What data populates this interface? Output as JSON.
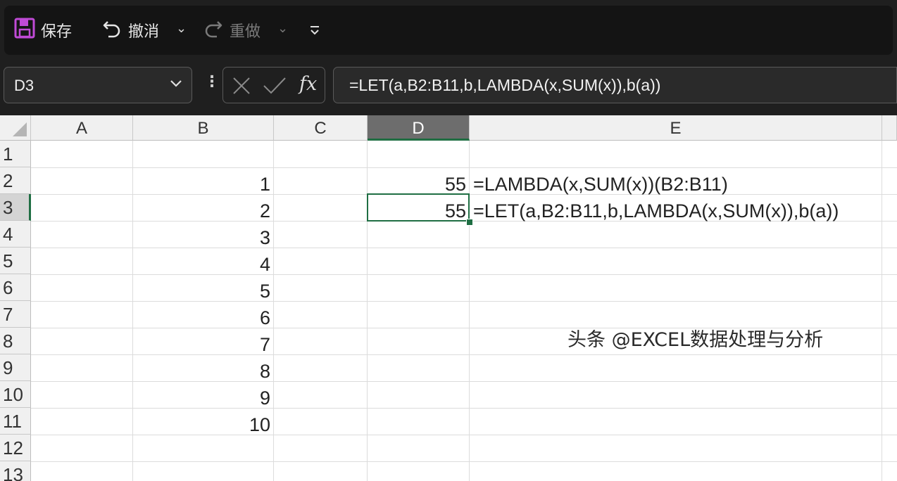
{
  "toolbar": {
    "save_label": "保存",
    "undo_label": "撤消",
    "redo_label": "重做"
  },
  "formula_bar": {
    "name_box": "D3",
    "fx_label": "fx",
    "formula": "=LET(a,B2:B11,b,LAMBDA(x,SUM(x)),b(a))"
  },
  "grid": {
    "columns": [
      "A",
      "B",
      "C",
      "D",
      "E"
    ],
    "selected_column": "D",
    "rows": [
      "1",
      "2",
      "3",
      "4",
      "5",
      "6",
      "7",
      "8",
      "9",
      "10",
      "11",
      "12",
      "13"
    ],
    "selected_row": "3",
    "column_b_values": [
      "1",
      "2",
      "3",
      "4",
      "5",
      "6",
      "7",
      "8",
      "9",
      "10"
    ],
    "d2_value": "55",
    "d3_value": "55",
    "e2_text": "=LAMBDA(x,SUM(x))(B2:B11)",
    "e3_text": "=LET(a,B2:B11,b,LAMBDA(x,SUM(x)),b(a))"
  },
  "watermark": "头条 @EXCEL数据处理与分析",
  "colors": {
    "selection": "#1f6e43",
    "save_icon": "#c04ad6"
  }
}
